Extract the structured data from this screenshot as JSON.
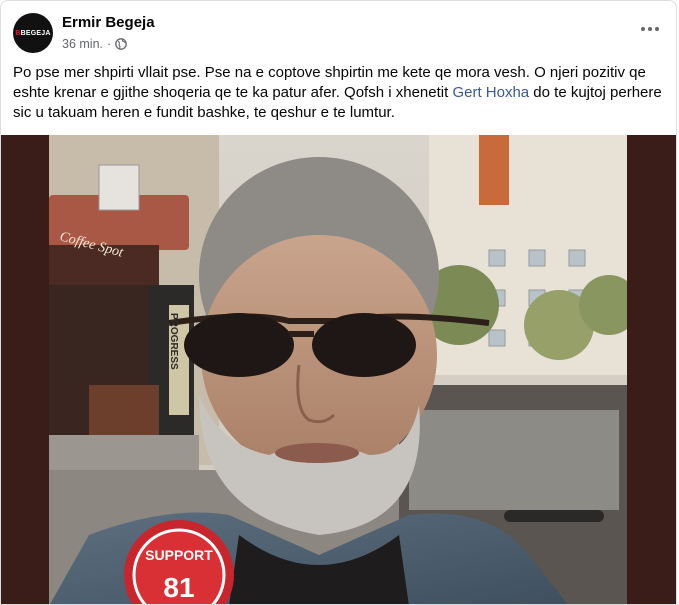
{
  "post": {
    "author": "Ermir Begeja",
    "avatar_text_mark": "B",
    "avatar_text": "BEGEJA",
    "time": "36 min.",
    "separator": "·",
    "privacy_icon": "globe-icon",
    "more_icon": "more-options-icon",
    "text_part1": "Po pse mer shpirti vllait pse. Pse na e coptove shpirtin me kete qe mora vesh. O njeri pozitiv qe eshte krenar e gjithe shoqeria qe te ka patur afer. Qofsh i xhenetit ",
    "mention": "Gert Hoxha",
    "text_part2": " do te kujtoj perhere sic u takuam heren e fundit bashke, te qeshur e te lumtur.",
    "photo": {
      "sign_coffee": "Coffee Spot",
      "sign_vertical": "PROGRESS",
      "patch_text": "SUPPORT",
      "patch_number": "81"
    },
    "colors": {
      "mention": "#385898",
      "secondary_text": "#65676b",
      "photo_border": "#3a1c18"
    }
  }
}
